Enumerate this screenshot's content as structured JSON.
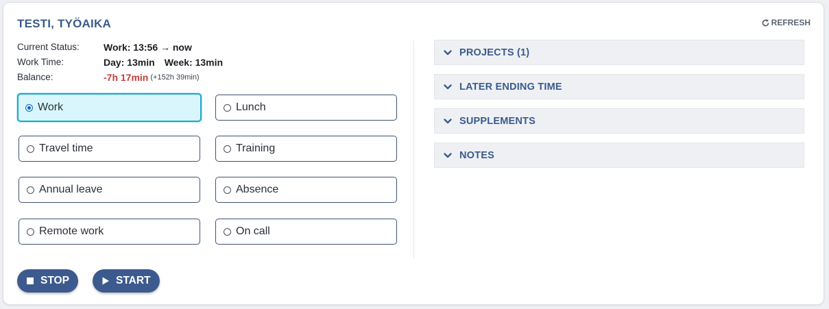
{
  "header": {
    "title": "TESTI, TYÖAIKA",
    "refresh_label": "REFRESH"
  },
  "status": {
    "current_status_label": "Current Status:",
    "current_status_value": "Work: 13:56 → now",
    "work_time_label": "Work Time:",
    "day_value": "Day: 13min",
    "week_value": "Week: 13min",
    "balance_label": "Balance:",
    "balance_value": "-7h 17min",
    "balance_extra": "(+152h 39min)"
  },
  "options": [
    {
      "label": "Work",
      "selected": true
    },
    {
      "label": "Lunch",
      "selected": false
    },
    {
      "label": "Travel time",
      "selected": false
    },
    {
      "label": "Training",
      "selected": false
    },
    {
      "label": "Annual leave",
      "selected": false
    },
    {
      "label": "Absence",
      "selected": false
    },
    {
      "label": "Remote work",
      "selected": false
    },
    {
      "label": "On call",
      "selected": false
    }
  ],
  "sections": [
    {
      "label": "PROJECTS (1)"
    },
    {
      "label": "LATER ENDING TIME"
    },
    {
      "label": "SUPPLEMENTS"
    },
    {
      "label": "NOTES"
    }
  ],
  "buttons": {
    "stop_label": "STOP",
    "start_label": "START"
  },
  "colors": {
    "accent": "#3a5a8c",
    "button": "#3d5a8f",
    "selected_border": "#1fa7c9",
    "selected_bg": "#d8f6fb",
    "negative": "#c83a3a"
  },
  "icons": {
    "refresh": "refresh-icon",
    "chevron": "chevron-down-icon",
    "stop": "stop-square-icon",
    "start": "play-triangle-icon"
  }
}
